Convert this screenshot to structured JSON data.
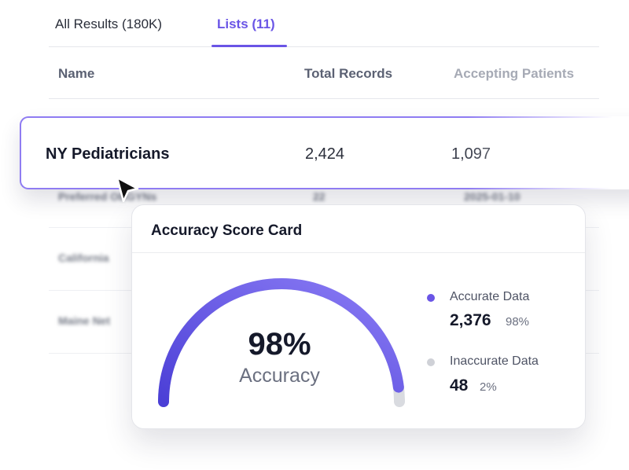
{
  "tabs": [
    {
      "label": "All Results (180K)",
      "active": false
    },
    {
      "label": "Lists (11)",
      "active": true
    }
  ],
  "table": {
    "columns": [
      "Name",
      "Total Records",
      "Accepting Patients"
    ],
    "highlighted_row": {
      "name": "NY Pediatricians",
      "total_records": "2,424",
      "accepting_patients": "1,097"
    },
    "blurred_rows": [
      {
        "name": "Preferred OBGYNs",
        "total_records": "22",
        "date": "2025-01-10"
      },
      {
        "name": "California",
        "total_records": "",
        "date": ""
      },
      {
        "name": "Maine Net",
        "total_records": "",
        "date": ""
      }
    ]
  },
  "card": {
    "title": "Accuracy Score Card",
    "gauge": {
      "value": "98%",
      "label": "Accuracy",
      "fraction": 0.98
    },
    "legend": [
      {
        "label": "Accurate Data",
        "count": "2,376",
        "percent": "98%",
        "color": "#6a55e6"
      },
      {
        "label": "Inaccurate Data",
        "count": "48",
        "percent": "2%",
        "color": "#cfd1d7"
      }
    ]
  },
  "colors": {
    "accent": "#6a55e6",
    "gauge_start": "#4b3fd6",
    "gauge_end": "#8b7cf5",
    "track": "#d9dbe0"
  },
  "icons": {
    "cursor": "mouse-pointer-icon"
  }
}
